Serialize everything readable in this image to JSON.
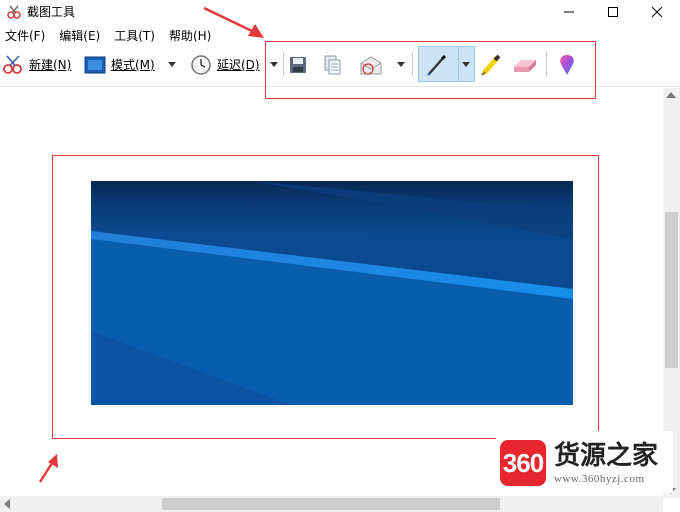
{
  "window": {
    "title": "截图工具"
  },
  "menu": [
    {
      "label": "文件(F)"
    },
    {
      "label": "编辑(E)"
    },
    {
      "label": "工具(T)"
    },
    {
      "label": "帮助(H)"
    }
  ],
  "toolbar": {
    "new_label": "新建(N)",
    "mode_label": "模式(M)",
    "delay_label": "延迟(D)",
    "icons": [
      "save-icon",
      "copy-icon",
      "send-email-icon",
      "pen-icon",
      "highlighter-icon",
      "eraser-icon",
      "paint3d-icon"
    ]
  },
  "colors": {
    "annotation": "#e2393b",
    "pen_active": "#cce4f7",
    "watermark_red": "#e8262d"
  },
  "watermark": {
    "badge": "360",
    "title": "货源之家",
    "url": "www.360hyzj.com"
  }
}
